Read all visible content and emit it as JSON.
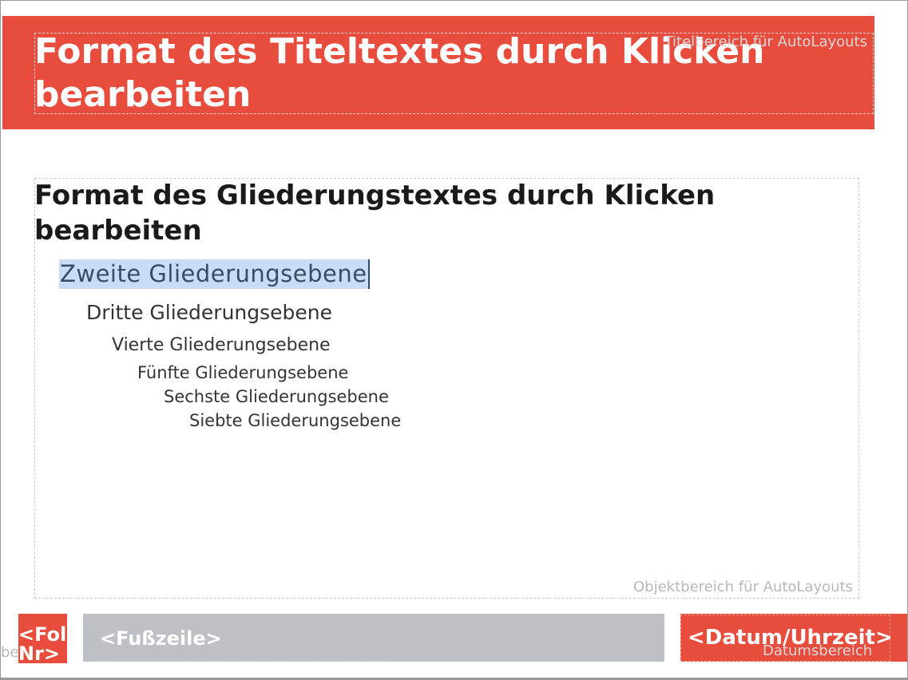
{
  "title": {
    "text": "Format des Titeltextes durch Klicken bearbeiten",
    "area_label": "Titelbereich für AutoLayouts"
  },
  "outline": {
    "level1": "Format des Gliederungstextes durch Klicken bearbeiten",
    "level2": "Zweite Gliederungsebene",
    "level3": "Dritte Gliederungsebene",
    "level4": "Vierte Gliederungsebene",
    "level5": "Fünfte Gliederungsebene",
    "level6": "Sechste Gliederungsebene",
    "level7": "Siebte Gliederungsebene",
    "area_label": "Objektbereich für AutoLayouts"
  },
  "footer": {
    "slide_number": "<Folien Nr>",
    "slide_number_area_label": "be",
    "footer_text": "<Fußzeile>",
    "date_text": "<Datum/Uhrzeit>",
    "date_area_label": "Datumsbereich"
  },
  "colors": {
    "accent": "#e84c3d",
    "footer_gray": "#bdc1c5",
    "selection": "#c9dcf5"
  }
}
